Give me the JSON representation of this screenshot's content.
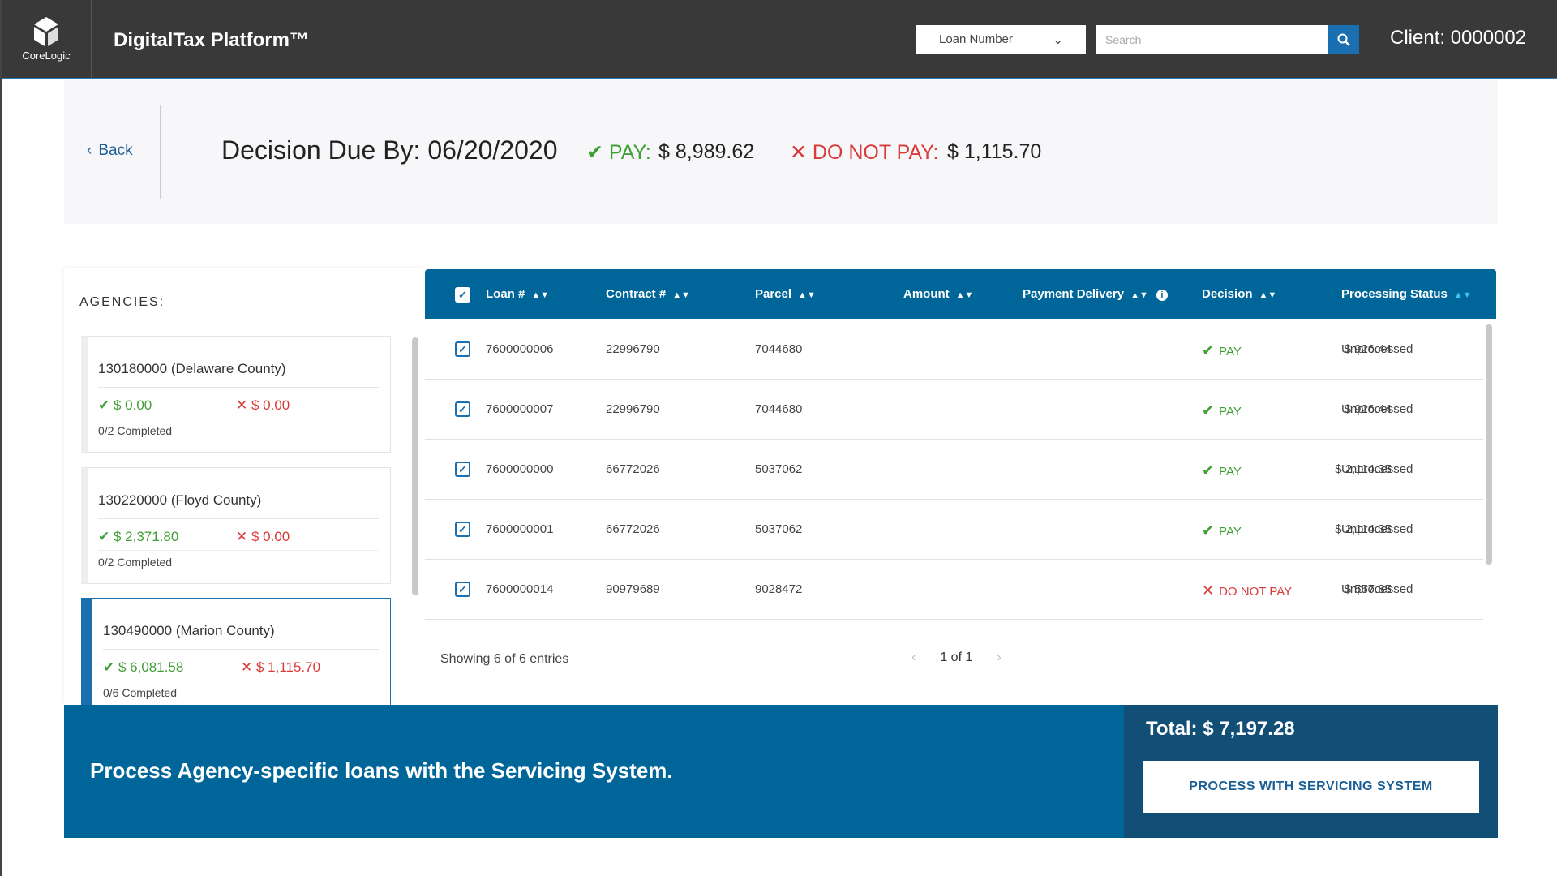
{
  "header": {
    "logo_text": "CoreLogic",
    "app_title": "DigitalTax Platform™",
    "search_type": "Loan Number",
    "search_placeholder": "Search",
    "client": "Client: 0000002"
  },
  "summary": {
    "back": "Back",
    "decision_due": "Decision Due By: 06/20/2020",
    "pay_label": "PAY:",
    "pay_amount": "$ 8,989.62",
    "dnp_label": "DO NOT PAY:",
    "dnp_amount": "$ 1,115.70"
  },
  "agencies": {
    "label": "AGENCIES:",
    "items": [
      {
        "name": "130180000 (Delaware County)",
        "pay": "$ 0.00",
        "dnp": "$ 0.00",
        "completed": "0/2 Completed",
        "selected": false
      },
      {
        "name": "130220000 (Floyd County)",
        "pay": "$ 2,371.80",
        "dnp": "$ 0.00",
        "completed": "0/2 Completed",
        "selected": false
      },
      {
        "name": "130490000 (Marion County)",
        "pay": "$ 6,081.58",
        "dnp": "$ 1,115.70",
        "completed": "0/6 Completed",
        "selected": true
      }
    ]
  },
  "table": {
    "columns": [
      "Loan #",
      "Contract #",
      "Parcel",
      "Amount",
      "Payment Delivery",
      "Decision",
      "Processing Status"
    ],
    "rows": [
      {
        "loan": "7600000006",
        "contract": "22996790",
        "parcel": "7044680",
        "amount": "$ 926.44",
        "delivery": "",
        "decision": "PAY",
        "status": "Unprocessed",
        "checked": true
      },
      {
        "loan": "7600000007",
        "contract": "22996790",
        "parcel": "7044680",
        "amount": "$ 926.44",
        "delivery": "",
        "decision": "PAY",
        "status": "Unprocessed",
        "checked": true
      },
      {
        "loan": "7600000000",
        "contract": "66772026",
        "parcel": "5037062",
        "amount": "$ 2,114.35",
        "delivery": "",
        "decision": "PAY",
        "status": "Unprocessed",
        "checked": true
      },
      {
        "loan": "7600000001",
        "contract": "66772026",
        "parcel": "5037062",
        "amount": "$ 2,114.35",
        "delivery": "",
        "decision": "PAY",
        "status": "Unprocessed",
        "checked": true
      },
      {
        "loan": "7600000014",
        "contract": "90979689",
        "parcel": "9028472",
        "amount": "$ 557.85",
        "delivery": "",
        "decision": "DO NOT PAY",
        "status": "Unprocessed",
        "checked": true
      }
    ],
    "showing": "Showing 6 of 6 entries",
    "page": "1 of 1"
  },
  "banner": {
    "text": "Process Agency-specific loans with the Servicing System.",
    "total": "Total: $ 7,197.28",
    "button": "PROCESS WITH SERVICING SYSTEM"
  },
  "colors": {
    "brand": "#006699",
    "pay": "#3f9e35",
    "dnp": "#d93a3a",
    "header": "#393939"
  }
}
